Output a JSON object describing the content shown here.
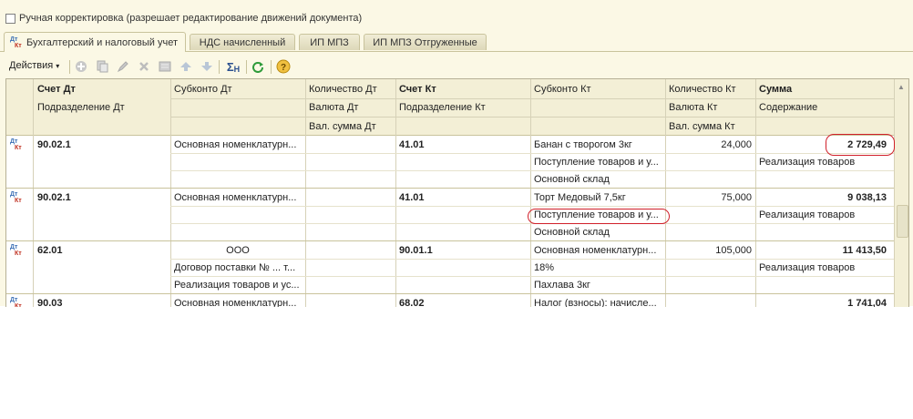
{
  "manual_adjust": {
    "label": "Ручная корректировка (разрешает редактирование движений документа)"
  },
  "tabs": [
    {
      "label": "Бухгалтерский и налоговый учет",
      "active": true
    },
    {
      "label": "НДС начисленный"
    },
    {
      "label": "ИП МПЗ"
    },
    {
      "label": "ИП МПЗ Отгруженные"
    }
  ],
  "icons": {
    "dt": "Дт",
    "kt": "Кт"
  },
  "toolbar": {
    "actions_label": "Действия",
    "buttons": [
      "add-icon",
      "copy-icon",
      "edit-icon",
      "delete-icon",
      "post-icon",
      "move-up-icon",
      "move-down-icon",
      "sum-icon",
      "refresh-icon",
      "help-icon"
    ]
  },
  "columns": {
    "row1": [
      "Счет Дт",
      "Субконто Дт",
      "Количество Дт",
      "Счет Кт",
      "Субконто Кт",
      "Количество Кт",
      "Сумма"
    ],
    "row2": [
      "Подразделение Дт",
      "",
      "Валюта Дт",
      "Подразделение Кт",
      "",
      "Валюта Кт",
      "Содержание"
    ],
    "row3": [
      "",
      "",
      "Вал. сумма Дт",
      "",
      "",
      "Вал. сумма Кт",
      ""
    ]
  },
  "rows": [
    {
      "acc_dt": "90.02.1",
      "sub_dt": [
        "Основная номенклатурн...",
        "",
        ""
      ],
      "qty_dt": "",
      "acc_kt": "41.01",
      "sub_kt": [
        "Банан с творогом 3кг",
        "Поступление товаров и у...",
        "Основной склад"
      ],
      "qty_kt": "24,000",
      "sum": "2 729,49",
      "content": "Реализация товаров"
    },
    {
      "acc_dt": "90.02.1",
      "sub_dt": [
        "Основная номенклатурн...",
        "",
        ""
      ],
      "qty_dt": "",
      "acc_kt": "41.01",
      "sub_kt": [
        "Торт Медовый 7,5кг",
        "Поступление товаров и у...",
        "Основной склад"
      ],
      "qty_kt": "75,000",
      "sum": "9 038,13",
      "content": "Реализация товаров"
    },
    {
      "acc_dt": "62.01",
      "sub_dt": [
        "ООО",
        "Договор поставки № ...    т...",
        "Реализация товаров и ус..."
      ],
      "qty_dt": "",
      "acc_kt": "90.01.1",
      "sub_kt": [
        "Основная номенклатурн...",
        "18%",
        "Пахлава 3кг"
      ],
      "qty_kt": "105,000",
      "sum": "11 413,50",
      "content": "Реализация товаров"
    },
    {
      "acc_dt": "90.03",
      "sub_dt": [
        "Основная номенклатурн...",
        "",
        ""
      ],
      "qty_dt": "",
      "acc_kt": "68.02",
      "sub_kt": [
        "Налог (взносы): начисле...",
        "",
        ""
      ],
      "qty_kt": "",
      "sum": "1 741,04",
      "content": ""
    }
  ],
  "colors": {
    "frame_bg": "#fbf8e5",
    "header_bg": "#f3efd6",
    "highlight_oval": "#d0202a"
  }
}
